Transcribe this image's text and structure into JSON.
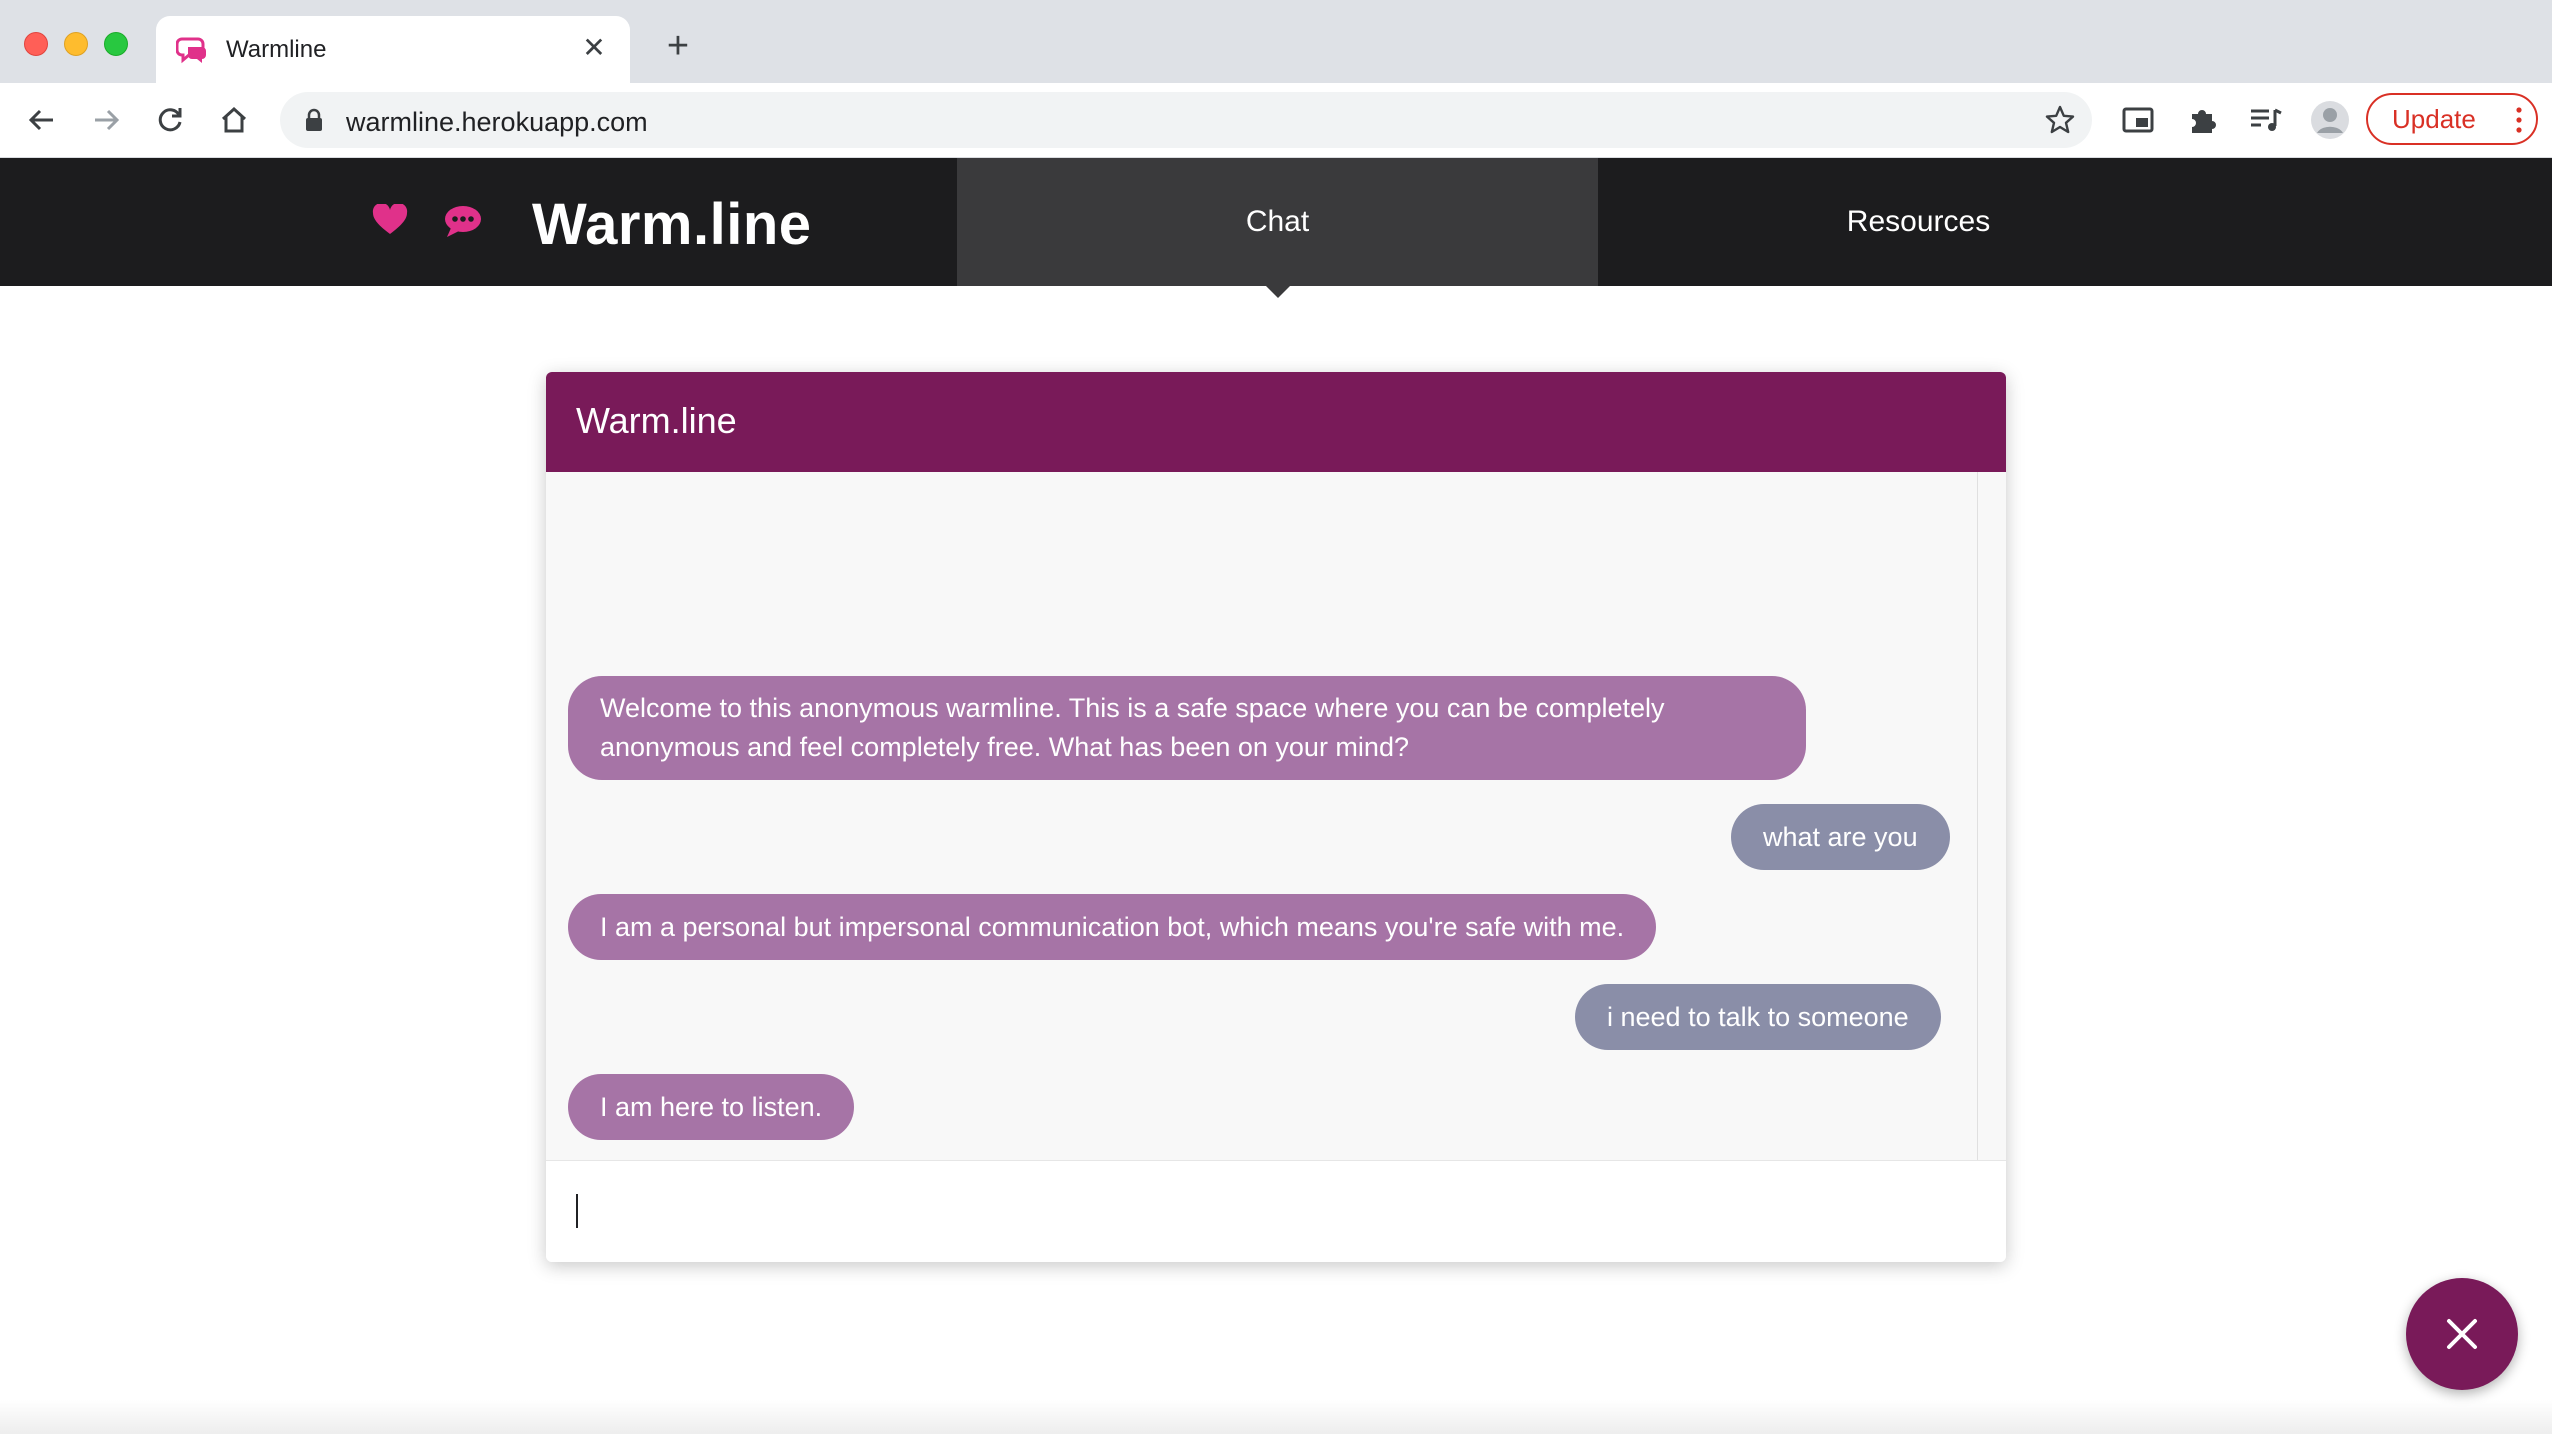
{
  "browser": {
    "tab_title": "Warmline",
    "url": "warmline.herokuapp.com",
    "update_label": "Update",
    "icons": [
      "back-icon",
      "forward-icon",
      "reload-icon",
      "home-icon",
      "lock-icon",
      "star-icon",
      "picture-in-picture-icon",
      "extensions-icon",
      "media-control-icon",
      "profile-icon",
      "more-vert-icon"
    ]
  },
  "site": {
    "brand": "Warm.line",
    "nav": {
      "chat": "Chat",
      "resources": "Resources"
    }
  },
  "chat": {
    "header_title": "Warm.line",
    "messages": [
      {
        "from": "bot",
        "line1": "Welcome to this anonymous warmline. This is a safe space where you can be completely",
        "line2": "anonymous and feel completely free. What has been on your mind?"
      },
      {
        "from": "user",
        "text": "what are you"
      },
      {
        "from": "bot",
        "text": "I am a personal but impersonal communication bot, which means you're safe with me."
      },
      {
        "from": "user",
        "text": "i need to talk to someone"
      },
      {
        "from": "bot",
        "text": "I am here to listen."
      }
    ],
    "input_value": ""
  },
  "colors": {
    "header": "#791a59",
    "bot_bubble": "#a674a6",
    "user_bubble": "#8a8ea8",
    "brand_accent": "#e0318a",
    "nav_bg": "#1c1c1e"
  }
}
